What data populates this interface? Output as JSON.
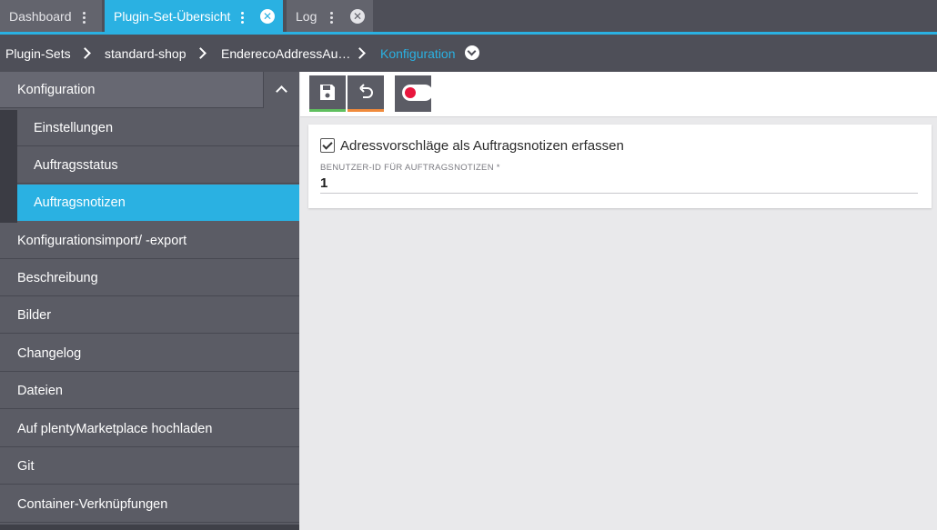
{
  "tabs": [
    {
      "label": "Dashboard"
    },
    {
      "label": "Plugin-Set-Übersicht"
    },
    {
      "label": "Log"
    }
  ],
  "breadcrumb": {
    "items": [
      "Plugin-Sets",
      "standard-shop",
      "EnderecoAddressAu…",
      "Konfiguration"
    ]
  },
  "sidebar": {
    "parent": "Konfiguration",
    "sub_items": [
      "Einstellungen",
      "Auftragsstatus",
      "Auftragsnotizen"
    ],
    "items": [
      "Konfigurationsimport/ -export",
      "Beschreibung",
      "Bilder",
      "Changelog",
      "Dateien",
      "Auf plentyMarketplace hochladen",
      "Git",
      "Container-Verknüpfungen"
    ]
  },
  "form": {
    "checkbox_label": "Adressvorschläge als Auftragsnotizen erfassen",
    "field_label": "BENUTZER-ID FÜR AUFTRAGSNOTIZEN *",
    "field_value": "1"
  },
  "colors": {
    "accent": "#2ab1e2",
    "save": "#5fbf5f",
    "undo": "#f08a3c",
    "toggle_off": "#e8163d"
  }
}
